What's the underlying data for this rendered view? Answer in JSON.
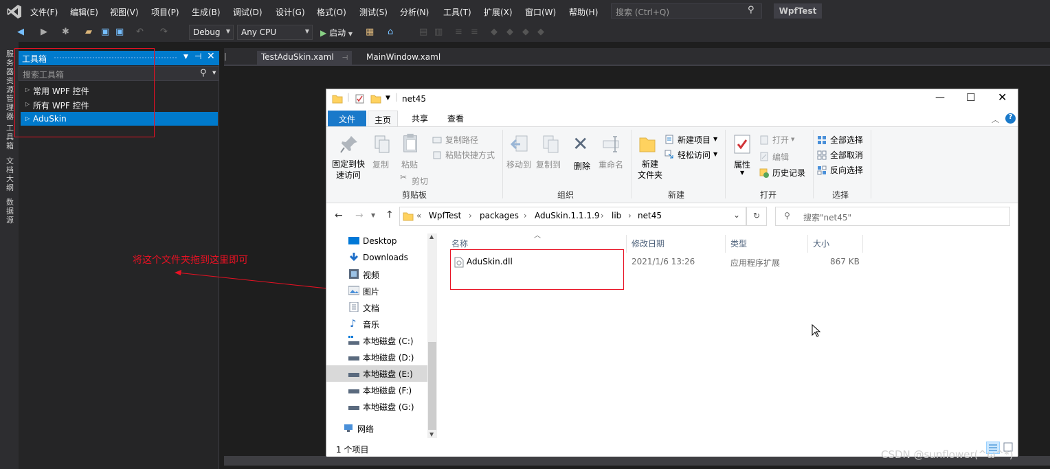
{
  "vs": {
    "menu": [
      "文件(F)",
      "编辑(E)",
      "视图(V)",
      "项目(P)",
      "生成(B)",
      "调试(D)",
      "设计(G)",
      "格式(O)",
      "测试(S)",
      "分析(N)",
      "工具(T)",
      "扩展(X)",
      "窗口(W)",
      "帮助(H)"
    ],
    "search_placeholder": "搜索 (Ctrl+Q)",
    "project_name": "WpfTest",
    "config": "Debug",
    "platform": "Any CPU",
    "start_label": "启动",
    "vertical_tabs": [
      "服务器资源管理器",
      "工具箱",
      "文档大纲",
      "数据源"
    ],
    "toolbox": {
      "title": "工具箱",
      "search_placeholder": "搜索工具箱",
      "items": [
        "常用 WPF 控件",
        "所有 WPF 控件",
        "AduSkin"
      ]
    },
    "doc_tabs": [
      "TestAduSkin.xaml",
      "MainWindow.xaml"
    ]
  },
  "annotation": {
    "note": "将这个文件夹拖到这里即可",
    "color": "#e81123"
  },
  "explorer": {
    "title": "net45",
    "ribbon_tabs": [
      "文件",
      "主页",
      "共享",
      "查看"
    ],
    "clipboard": {
      "pin": "固定到快\n速访问",
      "copy": "复制",
      "paste": "粘贴",
      "copy_path": "复制路径",
      "paste_shortcut": "粘贴快捷方式",
      "cut": "剪切",
      "group": "剪贴板"
    },
    "organize": {
      "move_to": "移动到",
      "copy_to": "复制到",
      "delete": "删除",
      "rename": "重命名",
      "group": "组织"
    },
    "new": {
      "new_folder": "新建\n文件夹",
      "new_item": "新建项目",
      "easy_access": "轻松访问",
      "group": "新建"
    },
    "open": {
      "properties": "属性",
      "open": "打开",
      "edit": "编辑",
      "history": "历史记录",
      "group": "打开"
    },
    "select": {
      "select_all": "全部选择",
      "select_none": "全部取消",
      "invert": "反向选择",
      "group": "选择"
    },
    "path": [
      "«",
      "WpfTest",
      "packages",
      "AduSkin.1.1.1.9",
      "lib",
      "net45"
    ],
    "search_placeholder": "搜索\"net45\"",
    "nav": [
      "Desktop",
      "Downloads",
      "视频",
      "图片",
      "文档",
      "音乐",
      "本地磁盘 (C:)",
      "本地磁盘 (D:)",
      "本地磁盘 (E:)",
      "本地磁盘 (F:)",
      "本地磁盘 (G:)",
      "网络"
    ],
    "columns": [
      "名称",
      "修改日期",
      "类型",
      "大小"
    ],
    "file": {
      "name": "AduSkin.dll",
      "date": "2021/1/6 13:26",
      "type": "应用程序扩展",
      "size": "867 KB"
    },
    "status": "1 个项目"
  },
  "watermark": "CSDN @sunflower(^ω^*)"
}
